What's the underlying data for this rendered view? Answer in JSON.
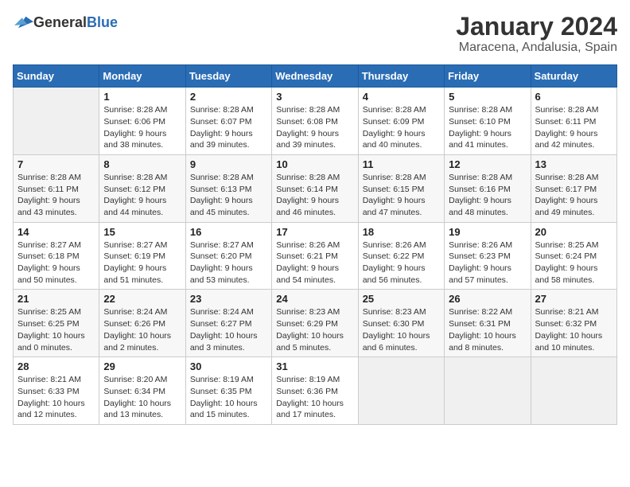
{
  "header": {
    "logo_general": "General",
    "logo_blue": "Blue",
    "month_year": "January 2024",
    "location": "Maracena, Andalusia, Spain"
  },
  "days_of_week": [
    "Sunday",
    "Monday",
    "Tuesday",
    "Wednesday",
    "Thursday",
    "Friday",
    "Saturday"
  ],
  "weeks": [
    [
      {
        "day": "",
        "sunrise": "",
        "sunset": "",
        "daylight": ""
      },
      {
        "day": "1",
        "sunrise": "Sunrise: 8:28 AM",
        "sunset": "Sunset: 6:06 PM",
        "daylight": "Daylight: 9 hours and 38 minutes."
      },
      {
        "day": "2",
        "sunrise": "Sunrise: 8:28 AM",
        "sunset": "Sunset: 6:07 PM",
        "daylight": "Daylight: 9 hours and 39 minutes."
      },
      {
        "day": "3",
        "sunrise": "Sunrise: 8:28 AM",
        "sunset": "Sunset: 6:08 PM",
        "daylight": "Daylight: 9 hours and 39 minutes."
      },
      {
        "day": "4",
        "sunrise": "Sunrise: 8:28 AM",
        "sunset": "Sunset: 6:09 PM",
        "daylight": "Daylight: 9 hours and 40 minutes."
      },
      {
        "day": "5",
        "sunrise": "Sunrise: 8:28 AM",
        "sunset": "Sunset: 6:10 PM",
        "daylight": "Daylight: 9 hours and 41 minutes."
      },
      {
        "day": "6",
        "sunrise": "Sunrise: 8:28 AM",
        "sunset": "Sunset: 6:11 PM",
        "daylight": "Daylight: 9 hours and 42 minutes."
      }
    ],
    [
      {
        "day": "7",
        "sunrise": "Sunrise: 8:28 AM",
        "sunset": "Sunset: 6:11 PM",
        "daylight": "Daylight: 9 hours and 43 minutes."
      },
      {
        "day": "8",
        "sunrise": "Sunrise: 8:28 AM",
        "sunset": "Sunset: 6:12 PM",
        "daylight": "Daylight: 9 hours and 44 minutes."
      },
      {
        "day": "9",
        "sunrise": "Sunrise: 8:28 AM",
        "sunset": "Sunset: 6:13 PM",
        "daylight": "Daylight: 9 hours and 45 minutes."
      },
      {
        "day": "10",
        "sunrise": "Sunrise: 8:28 AM",
        "sunset": "Sunset: 6:14 PM",
        "daylight": "Daylight: 9 hours and 46 minutes."
      },
      {
        "day": "11",
        "sunrise": "Sunrise: 8:28 AM",
        "sunset": "Sunset: 6:15 PM",
        "daylight": "Daylight: 9 hours and 47 minutes."
      },
      {
        "day": "12",
        "sunrise": "Sunrise: 8:28 AM",
        "sunset": "Sunset: 6:16 PM",
        "daylight": "Daylight: 9 hours and 48 minutes."
      },
      {
        "day": "13",
        "sunrise": "Sunrise: 8:28 AM",
        "sunset": "Sunset: 6:17 PM",
        "daylight": "Daylight: 9 hours and 49 minutes."
      }
    ],
    [
      {
        "day": "14",
        "sunrise": "Sunrise: 8:27 AM",
        "sunset": "Sunset: 6:18 PM",
        "daylight": "Daylight: 9 hours and 50 minutes."
      },
      {
        "day": "15",
        "sunrise": "Sunrise: 8:27 AM",
        "sunset": "Sunset: 6:19 PM",
        "daylight": "Daylight: 9 hours and 51 minutes."
      },
      {
        "day": "16",
        "sunrise": "Sunrise: 8:27 AM",
        "sunset": "Sunset: 6:20 PM",
        "daylight": "Daylight: 9 hours and 53 minutes."
      },
      {
        "day": "17",
        "sunrise": "Sunrise: 8:26 AM",
        "sunset": "Sunset: 6:21 PM",
        "daylight": "Daylight: 9 hours and 54 minutes."
      },
      {
        "day": "18",
        "sunrise": "Sunrise: 8:26 AM",
        "sunset": "Sunset: 6:22 PM",
        "daylight": "Daylight: 9 hours and 56 minutes."
      },
      {
        "day": "19",
        "sunrise": "Sunrise: 8:26 AM",
        "sunset": "Sunset: 6:23 PM",
        "daylight": "Daylight: 9 hours and 57 minutes."
      },
      {
        "day": "20",
        "sunrise": "Sunrise: 8:25 AM",
        "sunset": "Sunset: 6:24 PM",
        "daylight": "Daylight: 9 hours and 58 minutes."
      }
    ],
    [
      {
        "day": "21",
        "sunrise": "Sunrise: 8:25 AM",
        "sunset": "Sunset: 6:25 PM",
        "daylight": "Daylight: 10 hours and 0 minutes."
      },
      {
        "day": "22",
        "sunrise": "Sunrise: 8:24 AM",
        "sunset": "Sunset: 6:26 PM",
        "daylight": "Daylight: 10 hours and 2 minutes."
      },
      {
        "day": "23",
        "sunrise": "Sunrise: 8:24 AM",
        "sunset": "Sunset: 6:27 PM",
        "daylight": "Daylight: 10 hours and 3 minutes."
      },
      {
        "day": "24",
        "sunrise": "Sunrise: 8:23 AM",
        "sunset": "Sunset: 6:29 PM",
        "daylight": "Daylight: 10 hours and 5 minutes."
      },
      {
        "day": "25",
        "sunrise": "Sunrise: 8:23 AM",
        "sunset": "Sunset: 6:30 PM",
        "daylight": "Daylight: 10 hours and 6 minutes."
      },
      {
        "day": "26",
        "sunrise": "Sunrise: 8:22 AM",
        "sunset": "Sunset: 6:31 PM",
        "daylight": "Daylight: 10 hours and 8 minutes."
      },
      {
        "day": "27",
        "sunrise": "Sunrise: 8:21 AM",
        "sunset": "Sunset: 6:32 PM",
        "daylight": "Daylight: 10 hours and 10 minutes."
      }
    ],
    [
      {
        "day": "28",
        "sunrise": "Sunrise: 8:21 AM",
        "sunset": "Sunset: 6:33 PM",
        "daylight": "Daylight: 10 hours and 12 minutes."
      },
      {
        "day": "29",
        "sunrise": "Sunrise: 8:20 AM",
        "sunset": "Sunset: 6:34 PM",
        "daylight": "Daylight: 10 hours and 13 minutes."
      },
      {
        "day": "30",
        "sunrise": "Sunrise: 8:19 AM",
        "sunset": "Sunset: 6:35 PM",
        "daylight": "Daylight: 10 hours and 15 minutes."
      },
      {
        "day": "31",
        "sunrise": "Sunrise: 8:19 AM",
        "sunset": "Sunset: 6:36 PM",
        "daylight": "Daylight: 10 hours and 17 minutes."
      },
      {
        "day": "",
        "sunrise": "",
        "sunset": "",
        "daylight": ""
      },
      {
        "day": "",
        "sunrise": "",
        "sunset": "",
        "daylight": ""
      },
      {
        "day": "",
        "sunrise": "",
        "sunset": "",
        "daylight": ""
      }
    ]
  ]
}
